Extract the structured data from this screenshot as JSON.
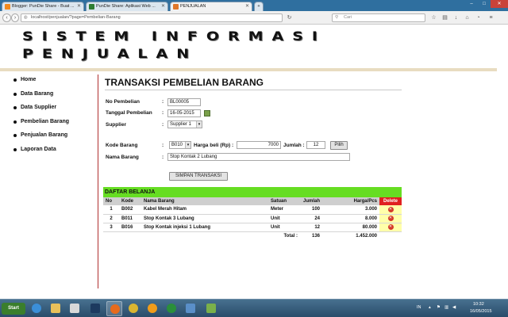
{
  "browser": {
    "tabs": [
      {
        "label": "Blogger: PunDie Share - Buat ..."
      },
      {
        "label": "PunDie Share: Aplikasi Web ..."
      },
      {
        "label": "PENJUALAN"
      }
    ],
    "url": "localhost/penjualan/?page=Pembelian-Barang",
    "search_placeholder": "Cari"
  },
  "site": {
    "banner_line1": "Sistem Informasi",
    "banner_line2": "Penjualan"
  },
  "sidebar": {
    "items": [
      {
        "label": "Home"
      },
      {
        "label": "Data Barang"
      },
      {
        "label": "Data Supplier"
      },
      {
        "label": "Pembelian Barang"
      },
      {
        "label": "Penjualan Barang"
      },
      {
        "label": "Laporan Data"
      }
    ]
  },
  "form": {
    "title": "TRANSAKSI PEMBELIAN BARANG",
    "no_pembelian_label": "No Pembelian",
    "no_pembelian_value": "BL00005",
    "tanggal_label": "Tanggal Pembelian",
    "tanggal_value": "16-05-2015",
    "supplier_label": "Supplier",
    "supplier_value": "Supplier 1",
    "kode_barang_label": "Kode Barang",
    "kode_barang_value": "B010",
    "harga_beli_label": "Harga beli (Rp) :",
    "harga_beli_value": "7000",
    "jumlah_label": "Jumlah :",
    "jumlah_value": "12",
    "pilih_label": "Pilih",
    "nama_barang_label": "Nama Barang",
    "nama_barang_value": "Stop Kontak 2 Lubang",
    "simpan_label": "SIMPAN TRANSAKSI",
    "colon": ":"
  },
  "table": {
    "title": "DAFTAR BELANJA",
    "headers": {
      "no": "No",
      "kode": "Kode",
      "nama": "Nama Barang",
      "satuan": "Satuan",
      "jumlah": "Jumlah",
      "harga": "Harga/Pcs",
      "delete": "Delete"
    },
    "rows": [
      {
        "no": "1",
        "kode": "B002",
        "nama": "Kabel Merah Hitam",
        "satuan": "Meter",
        "jumlah": "100",
        "harga": "3.000"
      },
      {
        "no": "2",
        "kode": "B011",
        "nama": "Stop Kontak 3 Lubang",
        "satuan": "Unit",
        "jumlah": "24",
        "harga": "8.000"
      },
      {
        "no": "3",
        "kode": "B016",
        "nama": "Stop Kontak injeksi 1 Lubang",
        "satuan": "Unit",
        "jumlah": "12",
        "harga": "80.000"
      }
    ],
    "total_label": "Total :",
    "total_jumlah": "136",
    "total_harga": "1.452.000"
  },
  "taskbar": {
    "start_label": "Start",
    "language": "IN",
    "time": "10:32",
    "date": "16/05/2015"
  },
  "colors": {
    "table_header": "#66dd22",
    "delete_header": "#e02020",
    "sidebar_divider": "#b03030"
  }
}
